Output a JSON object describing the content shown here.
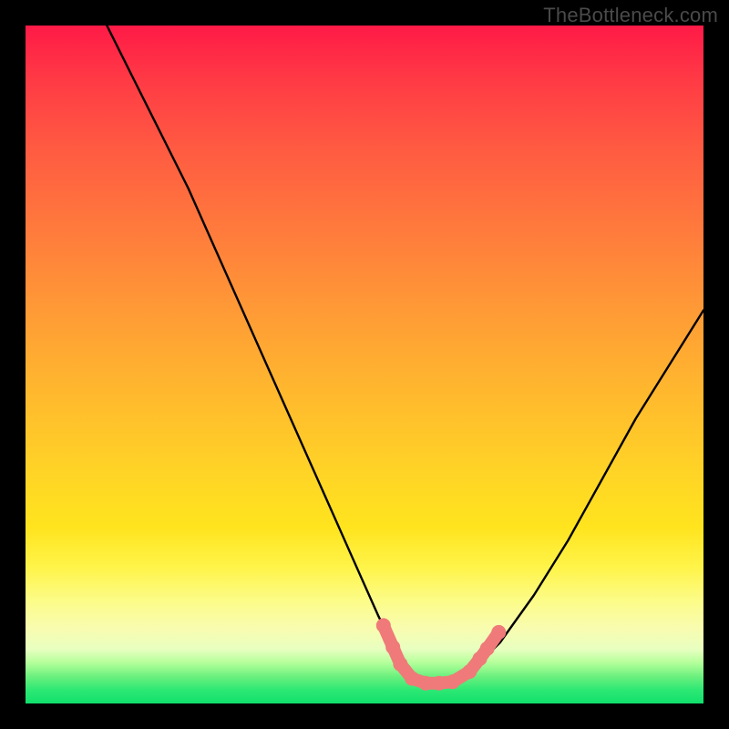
{
  "watermark": "TheBottleneck.com",
  "chart_data": {
    "type": "line",
    "title": "",
    "xlabel": "",
    "ylabel": "",
    "xlim": [
      0,
      100
    ],
    "ylim": [
      0,
      100
    ],
    "grid": false,
    "legend": false,
    "series": [
      {
        "name": "bottleneck-curve",
        "x": [
          12,
          16,
          20,
          24,
          28,
          32,
          36,
          40,
          44,
          48,
          52,
          55,
          57,
          59,
          61,
          63,
          66,
          70,
          75,
          80,
          85,
          90,
          95,
          100
        ],
        "y": [
          100,
          92,
          84,
          76,
          67,
          58,
          49,
          40,
          31,
          22,
          13,
          7,
          4,
          3,
          3,
          3,
          5,
          9,
          16,
          24,
          33,
          42,
          50,
          58
        ]
      }
    ],
    "markers": [
      {
        "name": "pink-dot",
        "x": 52.8,
        "y": 11.5
      },
      {
        "name": "pink-dot",
        "x": 54.2,
        "y": 8.3
      },
      {
        "name": "pink-dot",
        "x": 55.3,
        "y": 5.8
      },
      {
        "name": "pink-dot",
        "x": 57.0,
        "y": 3.7
      },
      {
        "name": "pink-dot",
        "x": 59.0,
        "y": 3.0
      },
      {
        "name": "pink-dot",
        "x": 61.0,
        "y": 3.0
      },
      {
        "name": "pink-dot",
        "x": 63.0,
        "y": 3.2
      },
      {
        "name": "pink-dot",
        "x": 65.5,
        "y": 4.7
      },
      {
        "name": "pink-dot",
        "x": 67.0,
        "y": 6.6
      },
      {
        "name": "pink-dot",
        "x": 68.1,
        "y": 8.1
      },
      {
        "name": "pink-dot",
        "x": 69.8,
        "y": 10.5
      }
    ],
    "colors": {
      "curve": "#000000",
      "markers": "#ef7a79",
      "gradient_top": "#ff1a47",
      "gradient_mid": "#ffd426",
      "gradient_bottom": "#10e06c"
    }
  }
}
